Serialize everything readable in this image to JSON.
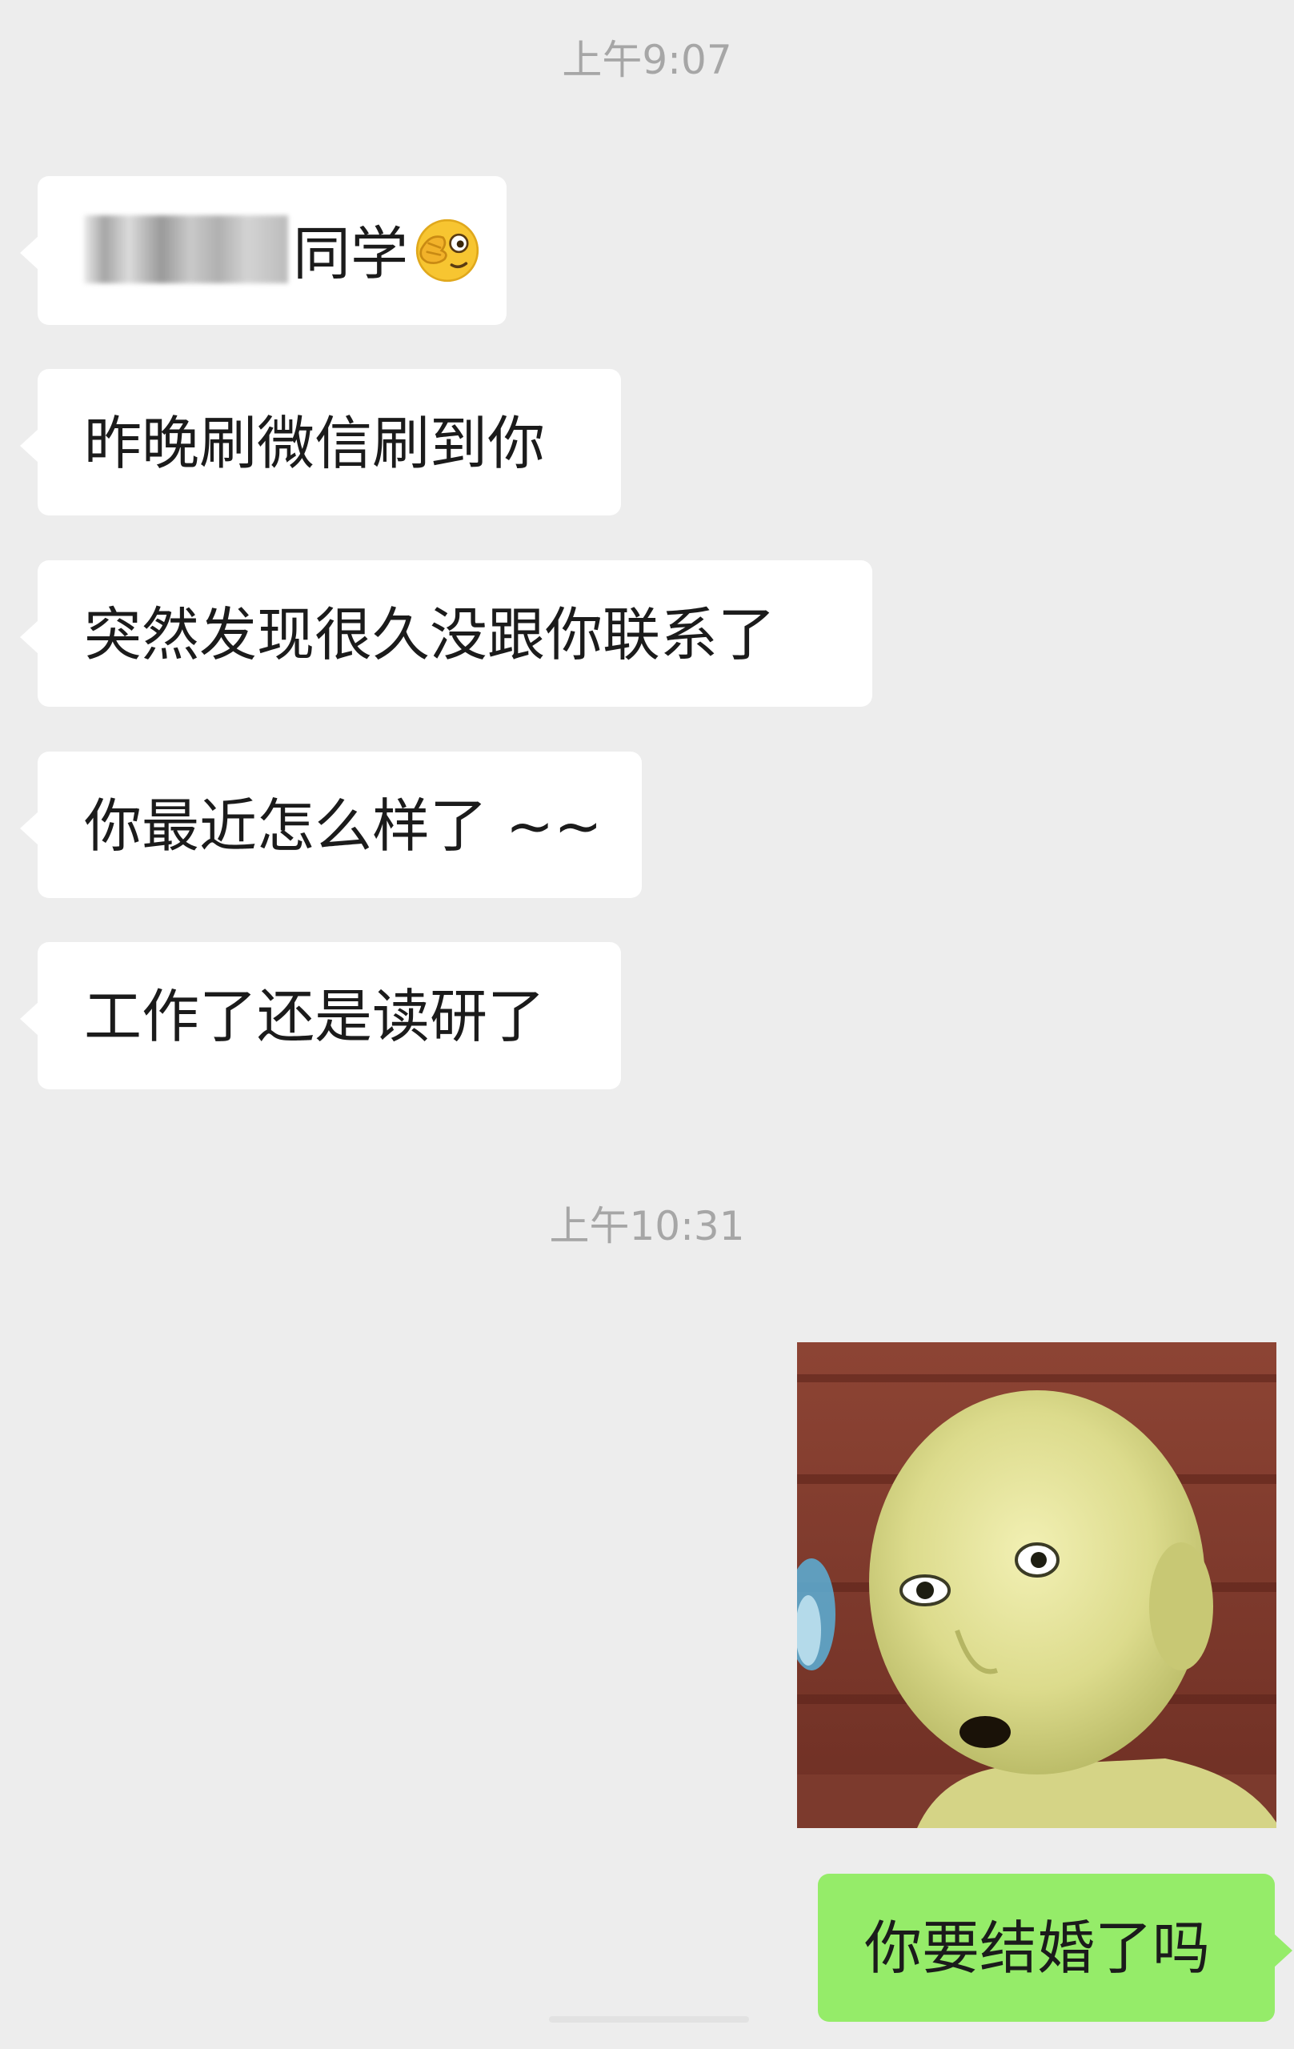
{
  "chat": {
    "timestamps": [
      "上午9:07",
      "上午10:31"
    ],
    "incoming_messages": [
      {
        "name_suffix": "同学"
      },
      {
        "text": "昨晚刷微信刷到你"
      },
      {
        "text": "突然发现很久没跟你联系了"
      },
      {
        "text": "你最近怎么样了 ~~"
      },
      {
        "text": "工作了还是读研了"
      }
    ],
    "outgoing_messages": [
      {
        "text": "你要结婚了吗"
      }
    ],
    "icons": {
      "greeting_emoji": "peek-wink-emoji",
      "sticker": "bald-yellow-character-sticker"
    },
    "colors": {
      "background": "#ededed",
      "incoming_bubble": "#ffffff",
      "outgoing_bubble": "#95ec69",
      "timestamp_text": "#a6a6a6"
    }
  }
}
